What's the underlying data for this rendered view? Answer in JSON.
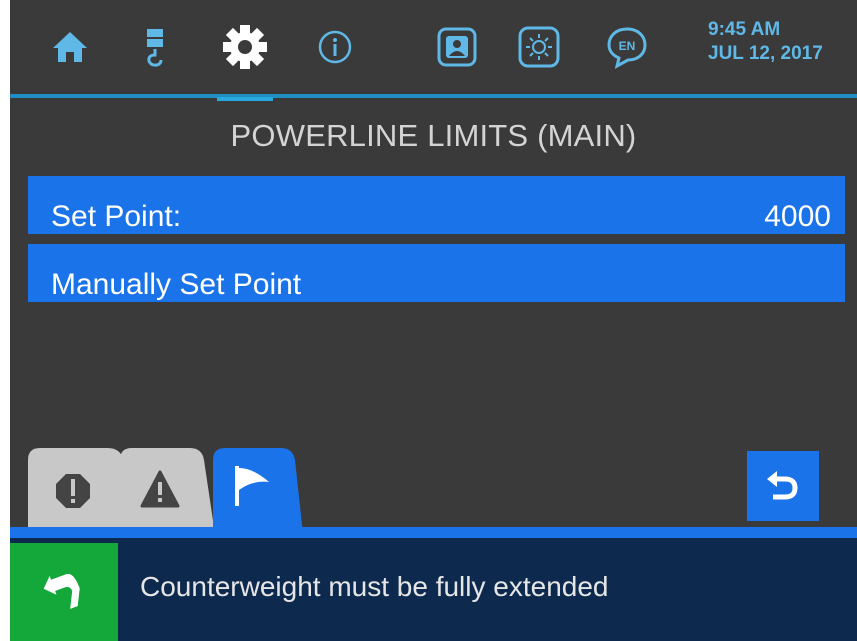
{
  "nav": {
    "icons": [
      "home-icon",
      "crane-hook-icon",
      "gear-icon",
      "info-icon",
      "operator-icon",
      "brightness-icon",
      "language-icon"
    ],
    "language_badge": "EN",
    "active": "gear-icon"
  },
  "clock": {
    "time": "9:45 AM",
    "date": "JUL 12, 2017"
  },
  "page": {
    "title": "POWERLINE LIMITS (MAIN)"
  },
  "rows": [
    {
      "label": "Set Point:",
      "value": "4000"
    },
    {
      "label": "Manually Set Point",
      "value": ""
    }
  ],
  "tabs": {
    "items": [
      "error-icon",
      "warning-icon",
      "flag-icon"
    ],
    "active": "flag-icon",
    "back": "back-arrow-icon"
  },
  "status": {
    "icon": "turn-arrow-icon",
    "message": "Counterweight must be fully extended"
  },
  "colors": {
    "background": "#3a3a3a",
    "accent": "#1a73e8",
    "clock": "#5fb8e6",
    "status_bar": "#0d2a4e",
    "status_icon": "#14a83b",
    "inactive_tab": "#c8c8c8"
  }
}
